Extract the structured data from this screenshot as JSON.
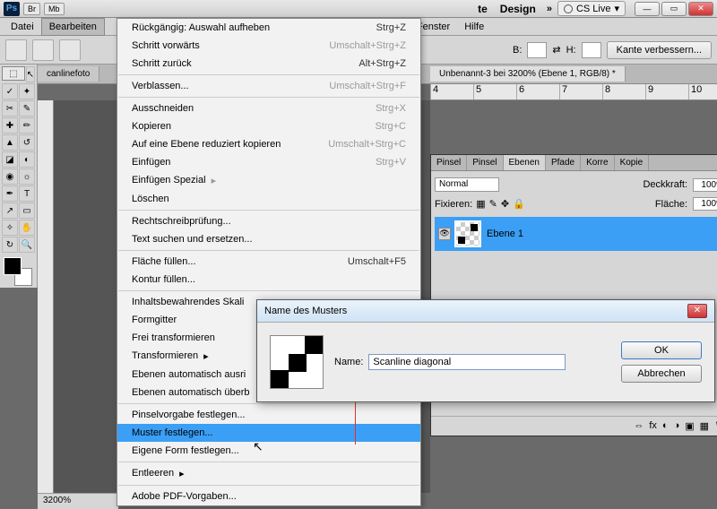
{
  "titlebar": {
    "br": "Br",
    "mb": "Mb",
    "workspace2": "Design",
    "arrow": "»",
    "cslive": "CS Live",
    "spacer": "te"
  },
  "menubar": {
    "file": "Datei",
    "edit": "Bearbeiten",
    "window": "Fenster",
    "help": "Hilfe"
  },
  "toolbar": {
    "b": "B:",
    "h": "H:",
    "refine": "Kante verbessern..."
  },
  "doctabs": {
    "left": "canlinefoto",
    "right": "Unbenannt-3 bei 3200% (Ebene 1, RGB/8) *"
  },
  "ruler": [
    "4",
    "5",
    "6",
    "7",
    "8",
    "9",
    "10"
  ],
  "status": "3200%",
  "dropdown": {
    "undo": {
      "label": "Rückgängig: Auswahl aufheben",
      "sc": "Strg+Z"
    },
    "stepfwd": {
      "label": "Schritt vorwärts",
      "sc": "Umschalt+Strg+Z"
    },
    "stepback": {
      "label": "Schritt zurück",
      "sc": "Alt+Strg+Z"
    },
    "fade": {
      "label": "Verblassen...",
      "sc": "Umschalt+Strg+F"
    },
    "cut": {
      "label": "Ausschneiden",
      "sc": "Strg+X"
    },
    "copy": {
      "label": "Kopieren",
      "sc": "Strg+C"
    },
    "copym": {
      "label": "Auf eine Ebene reduziert kopieren",
      "sc": "Umschalt+Strg+C"
    },
    "paste": {
      "label": "Einfügen",
      "sc": "Strg+V"
    },
    "pastesp": {
      "label": "Einfügen Spezial"
    },
    "delete": {
      "label": "Löschen"
    },
    "spell": {
      "label": "Rechtschreibprüfung..."
    },
    "findrepl": {
      "label": "Text suchen und ersetzen..."
    },
    "fill": {
      "label": "Fläche füllen...",
      "sc": "Umschalt+F5"
    },
    "stroke": {
      "label": "Kontur füllen..."
    },
    "contentaware": {
      "label": "Inhaltsbewahrendes Skali"
    },
    "puppet": {
      "label": "Formgitter"
    },
    "freetrans": {
      "label": "Frei transformieren"
    },
    "transform": {
      "label": "Transformieren"
    },
    "autoalign": {
      "label": "Ebenen automatisch ausri"
    },
    "autoblend": {
      "label": "Ebenen automatisch überb"
    },
    "brushpreset": {
      "label": "Pinselvorgabe festlegen..."
    },
    "pattern": {
      "label": "Muster festlegen..."
    },
    "shape": {
      "label": "Eigene Form festlegen..."
    },
    "purge": {
      "label": "Entleeren"
    },
    "pdf": {
      "label": "Adobe PDF-Vorgaben..."
    }
  },
  "layerspanel": {
    "tabs": [
      "Pinsel",
      "Pinsel",
      "Ebenen",
      "Pfade",
      "Korre",
      "Kopie"
    ],
    "blendmode": "Normal",
    "opacity_label": "Deckkraft:",
    "opacity": "100%",
    "lock": "Fixieren:",
    "fill_label": "Fläche:",
    "fill": "100%",
    "layer1": "Ebene 1"
  },
  "dialog": {
    "title": "Name des Musters",
    "name_label": "Name:",
    "name_value": "Scanline diagonal",
    "ok": "OK",
    "cancel": "Abbrechen"
  }
}
